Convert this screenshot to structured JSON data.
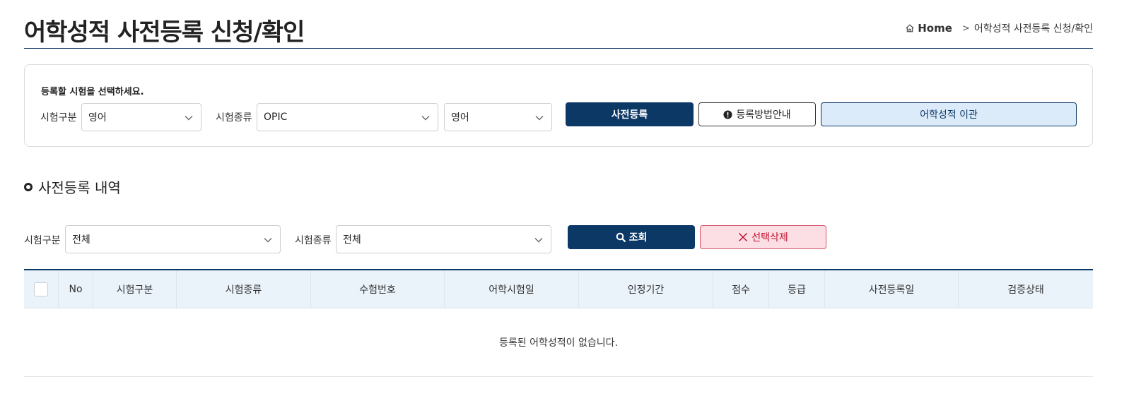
{
  "header": {
    "title": "어학성적 사전등록 신청/확인",
    "breadcrumb": {
      "home": "Home",
      "current": "어학성적 사전등록 신청/확인"
    }
  },
  "registration": {
    "instruction": "등록할 시험을 선택하세요.",
    "exam_category_label": "시험구분",
    "exam_category_value": "영어",
    "exam_type_label": "시험종류",
    "exam_type_value": "OPIC",
    "language_value": "영어",
    "pre_register_button": "사전등록",
    "guide_button": "등록방법안내",
    "transfer_button": "어학성적 이관"
  },
  "history": {
    "section_title": "사전등록 내역",
    "filter_category_label": "시험구분",
    "filter_category_value": "전체",
    "filter_type_label": "시험종류",
    "filter_type_value": "전체",
    "search_button": "조회",
    "delete_button": "선택삭제"
  },
  "table": {
    "columns": [
      "No",
      "시험구분",
      "시험종류",
      "수험번호",
      "어학시험일",
      "인정기간",
      "점수",
      "등급",
      "사전등록일",
      "검증상태"
    ],
    "empty_message": "등록된 어학성적이 없습니다."
  },
  "colors": {
    "primary": "#0c3866",
    "light_blue": "#dcebfa",
    "danger": "#c0112f",
    "danger_bg": "#fbdfe4"
  }
}
